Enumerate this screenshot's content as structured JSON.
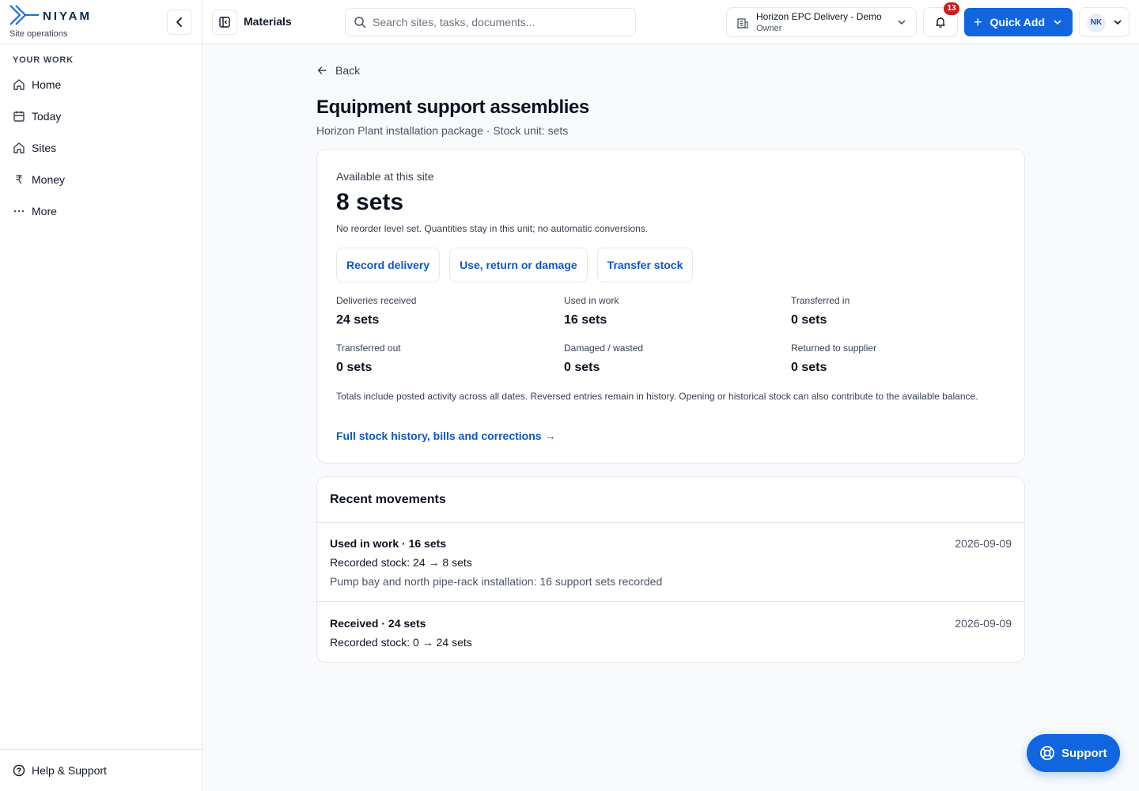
{
  "brand": {
    "name": "NIYAM",
    "tagline": "Site operations"
  },
  "sidebar": {
    "section": "YOUR WORK",
    "items": [
      {
        "label": "Home",
        "icon": "home-icon"
      },
      {
        "label": "Today",
        "icon": "calendar-icon"
      },
      {
        "label": "Sites",
        "icon": "home-icon"
      },
      {
        "label": "Money",
        "icon": "rupee-icon"
      },
      {
        "label": "More",
        "icon": "ellipsis-icon"
      }
    ],
    "help": "Help & Support"
  },
  "topbar": {
    "page": "Materials",
    "search_placeholder": "Search sites, tasks, documents...",
    "org_name": "Horizon EPC Delivery - Demo",
    "org_role": "Owner",
    "notifications": "13",
    "quick_add": "Quick Add",
    "user_initials": "NK"
  },
  "page": {
    "back": "Back",
    "title": "Equipment support assemblies",
    "subtitle": "Horizon Plant installation package · Stock unit: sets"
  },
  "stock": {
    "available_label": "Available at this site",
    "available_value": "8 sets",
    "note": "No reorder level set. Quantities stay in this unit; no automatic conversions.",
    "actions": [
      "Record delivery",
      "Use, return or damage",
      "Transfer stock"
    ],
    "stats": [
      {
        "label": "Deliveries received",
        "value": "24 sets"
      },
      {
        "label": "Used in work",
        "value": "16 sets"
      },
      {
        "label": "Transferred in",
        "value": "0 sets"
      },
      {
        "label": "Transferred out",
        "value": "0 sets"
      },
      {
        "label": "Damaged / wasted",
        "value": "0 sets"
      },
      {
        "label": "Returned to supplier",
        "value": "0 sets"
      }
    ],
    "footnote": "Totals include posted activity across all dates. Reversed entries remain in history. Opening or historical stock can also contribute to the available balance.",
    "history_link": "Full stock history, bills and corrections →"
  },
  "movements": {
    "title": "Recent movements",
    "items": [
      {
        "heading": "Used in work · 16 sets",
        "date": "2026-09-09",
        "stock": "Recorded stock: 24 → 8 sets",
        "note": "Pump bay and north pipe-rack installation: 16 support sets recorded"
      },
      {
        "heading": "Received · 24 sets",
        "date": "2026-09-09",
        "stock": "Recorded stock: 0 → 24 sets",
        "note": ""
      }
    ]
  },
  "support": "Support",
  "colors": {
    "primary": "#1166e0",
    "link": "#1056c9",
    "badge": "#c81e1e"
  }
}
